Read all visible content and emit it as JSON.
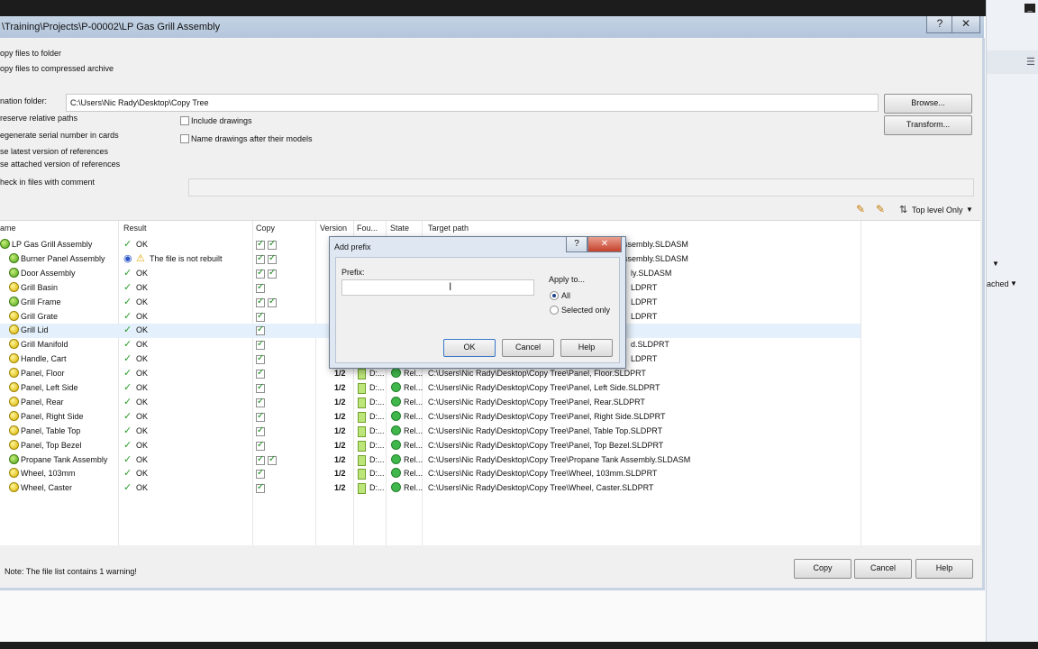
{
  "window": {
    "title": "\\Training\\Projects\\P-00002\\LP Gas Grill Assembly",
    "help_btn": "?",
    "close_btn": "✕"
  },
  "options": {
    "copy_to_folder": "opy files to folder",
    "copy_to_archive": "opy files to compressed archive",
    "destination_label": "nation folder:",
    "destination_value": "C:\\Users\\Nic Rady\\Desktop\\Copy Tree",
    "browse": "Browse...",
    "transform": "Transform...",
    "preserve_paths": "reserve relative paths",
    "regenerate_serial": "egenerate serial number in cards",
    "use_latest": "se latest version of references",
    "use_attached": "se attached version of references",
    "check_in": "heck in files with comment",
    "include_drawings": "Include drawings",
    "name_drawings": "Name drawings after their models",
    "top_level": "Top level Only"
  },
  "table": {
    "headers": {
      "name": "ame",
      "result": "Result",
      "copy": "Copy",
      "version": "Version",
      "found": "Fou...",
      "state": "State",
      "target": "Target path"
    },
    "rows": [
      {
        "name": "LP Gas Grill Assembly",
        "kind": "asm",
        "result": "OK",
        "warn": false,
        "copy2": true,
        "version": "",
        "found": "",
        "state": "",
        "target": "ssembly.SLDASM"
      },
      {
        "name": "Burner Panel Assembly",
        "kind": "asm",
        "result": "The file is not rebuilt",
        "warn": true,
        "copy2": true,
        "version": "",
        "found": "",
        "state": "",
        "target": "ssembly.SLDASM"
      },
      {
        "name": "Door Assembly",
        "kind": "asm",
        "result": "OK",
        "warn": false,
        "copy2": true,
        "version": "",
        "found": "",
        "state": "",
        "target": "ly.SLDASM"
      },
      {
        "name": "Grill Basin",
        "kind": "part",
        "result": "OK",
        "warn": false,
        "copy2": false,
        "version": "",
        "found": "",
        "state": "",
        "target": "LDPRT"
      },
      {
        "name": "Grill Frame",
        "kind": "asm",
        "result": "OK",
        "warn": false,
        "copy2": true,
        "version": "",
        "found": "",
        "state": "",
        "target": "LDPRT"
      },
      {
        "name": "Grill Grate",
        "kind": "part",
        "result": "OK",
        "warn": false,
        "copy2": false,
        "version": "",
        "found": "",
        "state": "",
        "target": "LDPRT"
      },
      {
        "name": "Grill Lid",
        "kind": "part",
        "result": "OK",
        "warn": false,
        "copy2": false,
        "version": "",
        "found": "",
        "state": "",
        "target": "",
        "selected": true
      },
      {
        "name": "Grill Manifold",
        "kind": "part",
        "result": "OK",
        "warn": false,
        "copy2": false,
        "version": "",
        "found": "",
        "state": "",
        "target": "d.SLDPRT"
      },
      {
        "name": "Handle, Cart",
        "kind": "part",
        "result": "OK",
        "warn": false,
        "copy2": false,
        "version": "",
        "found": "",
        "state": "",
        "target": "LDPRT"
      },
      {
        "name": "Panel, Floor",
        "kind": "part",
        "result": "OK",
        "warn": false,
        "copy2": false,
        "version": "1/2",
        "found": "D:...",
        "state": "Rel...",
        "target": "C:\\Users\\Nic Rady\\Desktop\\Copy Tree\\Panel, Floor.SLDPRT"
      },
      {
        "name": "Panel, Left Side",
        "kind": "part",
        "result": "OK",
        "warn": false,
        "copy2": false,
        "version": "1/2",
        "found": "D:...",
        "state": "Rel...",
        "target": "C:\\Users\\Nic Rady\\Desktop\\Copy Tree\\Panel, Left Side.SLDPRT"
      },
      {
        "name": "Panel, Rear",
        "kind": "part",
        "result": "OK",
        "warn": false,
        "copy2": false,
        "version": "1/2",
        "found": "D:...",
        "state": "Rel...",
        "target": "C:\\Users\\Nic Rady\\Desktop\\Copy Tree\\Panel, Rear.SLDPRT"
      },
      {
        "name": "Panel, Right Side",
        "kind": "part",
        "result": "OK",
        "warn": false,
        "copy2": false,
        "version": "1/2",
        "found": "D:...",
        "state": "Rel...",
        "target": "C:\\Users\\Nic Rady\\Desktop\\Copy Tree\\Panel, Right Side.SLDPRT"
      },
      {
        "name": "Panel, Table Top",
        "kind": "part",
        "result": "OK",
        "warn": false,
        "copy2": false,
        "version": "1/2",
        "found": "D:...",
        "state": "Rel...",
        "target": "C:\\Users\\Nic Rady\\Desktop\\Copy Tree\\Panel, Table Top.SLDPRT"
      },
      {
        "name": "Panel, Top Bezel",
        "kind": "part",
        "result": "OK",
        "warn": false,
        "copy2": false,
        "version": "1/2",
        "found": "D:...",
        "state": "Rel...",
        "target": "C:\\Users\\Nic Rady\\Desktop\\Copy Tree\\Panel, Top Bezel.SLDPRT"
      },
      {
        "name": "Propane Tank Assembly",
        "kind": "asm",
        "result": "OK",
        "warn": false,
        "copy2": true,
        "version": "1/2",
        "found": "D:...",
        "state": "Rel...",
        "target": "C:\\Users\\Nic Rady\\Desktop\\Copy Tree\\Propane Tank Assembly.SLDASM"
      },
      {
        "name": "Wheel, 103mm",
        "kind": "part",
        "result": "OK",
        "warn": false,
        "copy2": false,
        "version": "1/2",
        "found": "D:...",
        "state": "Rel...",
        "target": "C:\\Users\\Nic Rady\\Desktop\\Copy Tree\\Wheel, 103mm.SLDPRT"
      },
      {
        "name": "Wheel, Caster",
        "kind": "part",
        "result": "OK",
        "warn": false,
        "copy2": false,
        "version": "1/2",
        "found": "D:...",
        "state": "Rel...",
        "target": "C:\\Users\\Nic Rady\\Desktop\\Copy Tree\\Wheel, Caster.SLDPRT"
      }
    ]
  },
  "footer": {
    "note": "Note: The file list contains 1 warning!",
    "copy": "Copy",
    "cancel": "Cancel",
    "help": "Help"
  },
  "dialog": {
    "title": "Add prefix",
    "help_btn": "?",
    "close_btn": "✕",
    "prefix_label": "Prefix:",
    "prefix_value": "",
    "apply_to": "Apply to...",
    "all": "All",
    "selected_only": "Selected only",
    "ok": "OK",
    "cancel": "Cancel",
    "help": "Help"
  },
  "side": {
    "attached": "ached"
  },
  "colors": {
    "ok_check": "#2a9d2a",
    "selection": "#e4f0fb",
    "titlebar": "#b4c6dc"
  }
}
